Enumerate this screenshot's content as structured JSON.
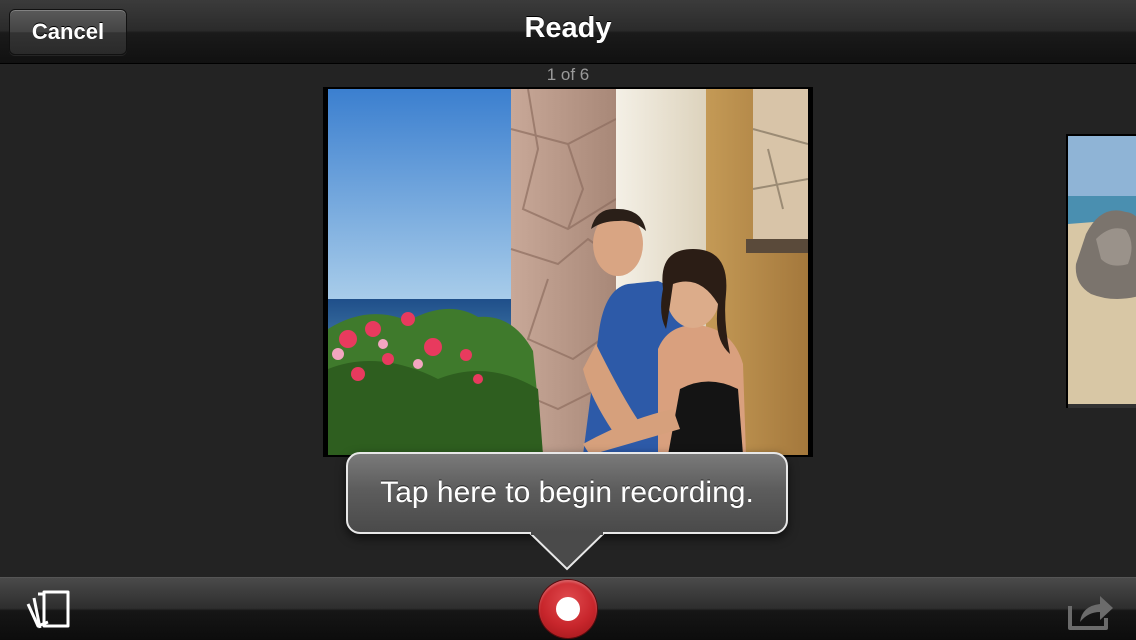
{
  "topbar": {
    "cancel_label": "Cancel",
    "title": "Ready"
  },
  "slideshow": {
    "counter": "1 of 6",
    "current_index": 1,
    "total": 6
  },
  "tooltip": {
    "text": "Tap here to begin recording."
  },
  "toolbar": {
    "left_icon": "photo-stack-icon",
    "center_icon": "record-icon",
    "right_icon": "share-icon"
  },
  "colors": {
    "record_red": "#c8262c",
    "background": "#232323"
  }
}
